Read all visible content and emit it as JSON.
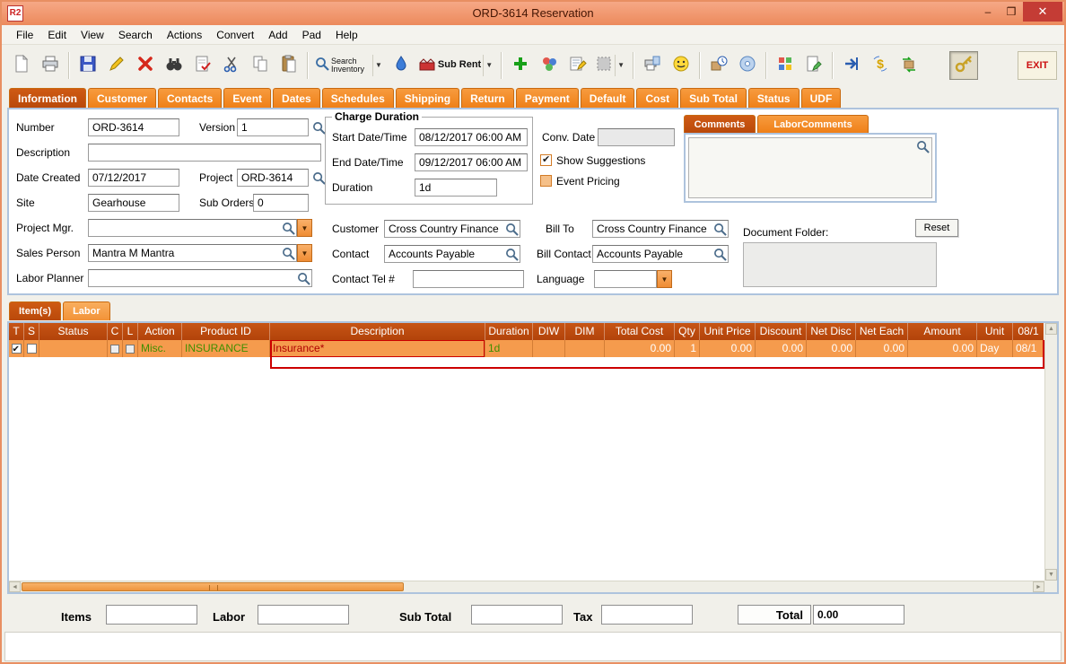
{
  "window": {
    "title": "ORD-3614 Reservation",
    "logo_text": "R2"
  },
  "menu": [
    "File",
    "Edit",
    "View",
    "Search",
    "Actions",
    "Convert",
    "Add",
    "Pad",
    "Help"
  ],
  "toolbar": {
    "search_inventory": "Search Inventory",
    "sub_rent": "Sub Rent",
    "exit": "EXIT"
  },
  "tabs": [
    "Information",
    "Customer",
    "Contacts",
    "Event",
    "Dates",
    "Schedules",
    "Shipping",
    "Return",
    "Payment",
    "Default",
    "Cost",
    "Sub Total",
    "Status",
    "UDF"
  ],
  "info": {
    "number_label": "Number",
    "number": "ORD-3614",
    "version_label": "Version",
    "version": "1",
    "description_label": "Description",
    "description": "",
    "date_created_label": "Date Created",
    "date_created": "07/12/2017",
    "project_label": "Project",
    "project": "ORD-3614",
    "site_label": "Site",
    "site": "Gearhouse",
    "sub_orders_label": "Sub Orders",
    "sub_orders": "0",
    "project_mgr_label": "Project Mgr.",
    "project_mgr": "",
    "sales_person_label": "Sales Person",
    "sales_person": "Mantra M Mantra",
    "labor_planner_label": "Labor Planner",
    "labor_planner": "",
    "charge_duration_legend": "Charge Duration",
    "start_label": "Start Date/Time",
    "start": "08/12/2017 06:00 AM",
    "end_label": "End Date/Time",
    "end": "09/12/2017 06:00 AM",
    "duration_label": "Duration",
    "duration": "1d",
    "conv_date_label": "Conv. Date",
    "conv_date": "",
    "show_suggestions_label": "Show Suggestions",
    "show_suggestions_checked": true,
    "event_pricing_label": "Event Pricing",
    "event_pricing_checked": false,
    "customer_label": "Customer",
    "customer": "Cross Country Finance",
    "bill_to_label": "Bill To",
    "bill_to": "Cross Country Finance",
    "contact_label": "Contact",
    "contact": "Accounts Payable",
    "bill_contact_label": "Bill Contact",
    "bill_contact": "Accounts Payable",
    "contact_tel_label": "Contact Tel #",
    "contact_tel": "",
    "language_label": "Language",
    "language": "",
    "comments_tab": "Comments",
    "labor_comments_tab": "LaborComments",
    "comments_text": "",
    "document_folder_label": "Document Folder:",
    "reset_button": "Reset"
  },
  "items_section": {
    "tab_items": "Item(s)",
    "tab_labor": "Labor"
  },
  "table": {
    "columns": [
      "T",
      "S",
      "Status",
      "C",
      "L",
      "Action",
      "Product ID",
      "Description",
      "Duration",
      "DIW",
      "DIM",
      "Total Cost",
      "Qty",
      "Unit Price",
      "Discount",
      "Net Disc",
      "Net Each",
      "Amount",
      "Unit",
      "08/1"
    ],
    "rows": [
      {
        "t_checked": true,
        "s_checked": false,
        "status": "",
        "c_checked": false,
        "l_checked": false,
        "action": "Misc.",
        "product_id": "INSURANCE",
        "description": "Insurance*",
        "duration": "1d",
        "diw": "",
        "dim": "",
        "total_cost": "0.00",
        "qty": "1",
        "unit_price": "0.00",
        "discount": "0.00",
        "net_disc": "0.00",
        "net_each": "0.00",
        "amount": "0.00",
        "unit": "Day",
        "start_date": "08/1"
      }
    ]
  },
  "summary": {
    "items_label": "Items",
    "items": "",
    "labor_label": "Labor",
    "labor": "",
    "sub_total_label": "Sub Total",
    "sub_total": "",
    "tax_label": "Tax",
    "tax": "",
    "total_label": "Total",
    "total": "0.00"
  },
  "theme": {
    "titlebar": "#ec8a5c",
    "tab_orange": "#ef8018",
    "tab_selected": "#b9490a",
    "table_header": "#b2430a",
    "row_highlight": "#f59b4d",
    "item_green": "#3f8f00",
    "alert_red": "#cc0000",
    "close_red": "#c43c35"
  }
}
